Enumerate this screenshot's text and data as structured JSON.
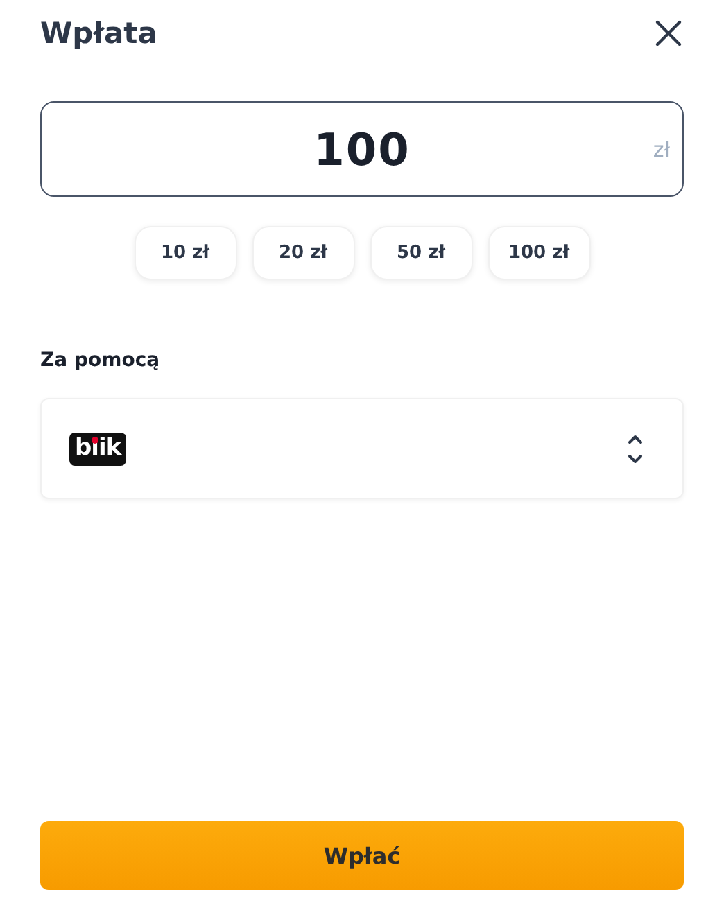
{
  "title": "Wpłata",
  "amount": {
    "value": "100",
    "currency": "zł"
  },
  "presets": [
    {
      "label": "10 zł"
    },
    {
      "label": "20 zł"
    },
    {
      "label": "50 zł"
    },
    {
      "label": "100 zł"
    }
  ],
  "method_label": "Za pomocą",
  "method": {
    "logo": "blik"
  },
  "submit": "Wpłać"
}
